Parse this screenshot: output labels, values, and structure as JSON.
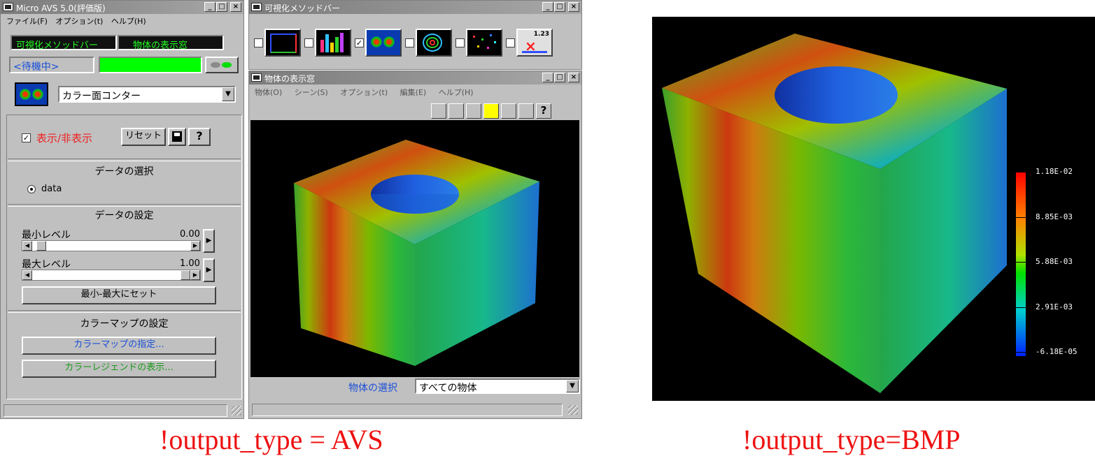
{
  "main_window": {
    "title": "Micro AVS 5.0(評価版)",
    "menu": [
      "ファイル(F)",
      "オプション(t)",
      "ヘルプ(H)"
    ],
    "tab_method_bar": "可視化メソッドバー",
    "tab_display_window": "物体の表示窓",
    "status_text": "<待機中>",
    "method_select_value": "カラー面コンター",
    "show_hide_label": "表示/非表示",
    "show_hide_checked": true,
    "reset_label": "リセット",
    "help_label": "?",
    "data_select_heading": "データの選択",
    "data_radio_label": "data",
    "data_settings_heading": "データの設定",
    "min_level_label": "最小レベル",
    "min_level_value": "0.00",
    "min_level_fraction": 0.0,
    "max_level_label": "最大レベル",
    "max_level_value": "1.00",
    "max_level_fraction": 1.0,
    "set_minmax_label": "最小-最大にセット",
    "colormap_heading": "カラーマップの設定",
    "colormap_spec_label": "カラーマップの指定...",
    "color_legend_label": "カラーレジェンドの表示..."
  },
  "method_bar_window": {
    "title": "可視化メソッドバー",
    "methods": [
      {
        "name": "frame-method",
        "checked": false
      },
      {
        "name": "bar-method",
        "checked": false
      },
      {
        "name": "color-contour-method",
        "checked": true
      },
      {
        "name": "contour-line-method",
        "checked": false
      },
      {
        "name": "scatter-method",
        "checked": false
      },
      {
        "name": "value-label-method",
        "checked": false,
        "badge": "1.23"
      }
    ]
  },
  "display_window": {
    "title": "物体の表示窓",
    "menu": [
      "物体(O)",
      "シーン(S)",
      "オプション(t)",
      "編集(E)",
      "ヘルプ(H)"
    ],
    "object_select_label": "物体の選択",
    "object_select_value": "すべての物体",
    "help_label": "?"
  },
  "bmp_output": {
    "legend_labels": [
      "1.18E-02",
      "8.85E-03",
      "5.88E-03",
      "2.91E-03",
      "-6.18E-05"
    ]
  },
  "captions": {
    "left": "!output_type = AVS",
    "right": "!output_type=BMP"
  },
  "colors": {
    "caption_red": "#ee1111",
    "tab_text_green": "#22ff22",
    "status_bar_green": "#00ff00",
    "show_hide_red": "#ee2222",
    "colormap_blue": "#1a4fd8",
    "legend_green": "#1a9a1a",
    "object_select_blue": "#1a4fd8"
  }
}
